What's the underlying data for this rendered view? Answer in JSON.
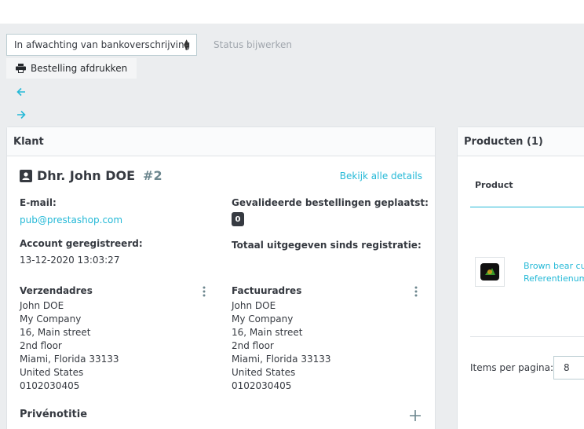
{
  "toolbar": {
    "status_select_value": "In afwachting van bankoverschrijving",
    "status_update_label": "Status bijwerken",
    "print_label": "Bestelling afdrukken"
  },
  "customer_card": {
    "title": "Klant",
    "customer_name": "Dhr. John DOE",
    "customer_id": "#2",
    "view_details_link": "Bekijk alle details",
    "email_label": "E-mail:",
    "email_value": "pub@prestashop.com",
    "registered_label": "Account geregistreerd:",
    "registered_value": "13-12-2020 13:03:27",
    "validated_orders_label": "Gevalideerde bestellingen geplaatst:",
    "validated_orders_count": "0",
    "total_spent_label": "Totaal uitgegeven sinds registratie:",
    "shipping": {
      "label": "Verzendadres",
      "lines": [
        "John DOE",
        "My Company",
        "16, Main street",
        "2nd floor",
        "Miami, Florida 33133",
        "United States",
        "0102030405"
      ]
    },
    "invoice": {
      "label": "Factuuradres",
      "lines": [
        "John DOE",
        "My Company",
        "16, Main street",
        "2nd floor",
        "Miami, Florida 33133",
        "United States",
        "0102030405"
      ]
    },
    "private_note_label": "Privénotitie"
  },
  "products_card": {
    "title": "Producten (1)",
    "column_product": "Product",
    "product_name": "Brown bear cus",
    "product_reference": "Referentienumr",
    "items_per_page_label": "Items per pagina:",
    "items_per_page_value": "8"
  }
}
